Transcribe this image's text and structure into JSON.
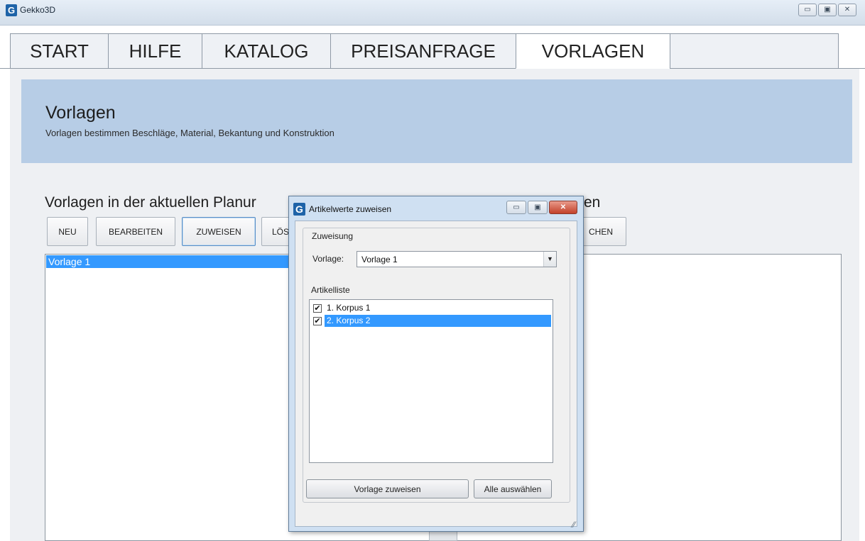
{
  "window": {
    "title": "Gekko3D",
    "app_icon": "G",
    "minimize": "▭",
    "maximize": "▣",
    "close": "✕"
  },
  "tabs": [
    {
      "label": "START"
    },
    {
      "label": "HILFE"
    },
    {
      "label": "KATALOG"
    },
    {
      "label": "PREISANFRAGE"
    },
    {
      "label": "VORLAGEN"
    }
  ],
  "header": {
    "title": "Vorlagen",
    "subtitle": "Vorlagen bestimmen Beschläge, Material, Bekantung und Konstruktion"
  },
  "left_section": {
    "title": "Vorlagen in der aktuellen Planur",
    "buttons": {
      "new": "NEU",
      "edit": "BEARBEITEN",
      "assign": "ZUWEISEN",
      "delete": "LÖS"
    },
    "list": [
      "Vorlage 1"
    ]
  },
  "right_section": {
    "title_fragment": "en",
    "button_fragment": "CHEN"
  },
  "dialog": {
    "title": "Artikelwerte zuweisen",
    "icon": "G",
    "group_label": "Zuweisung",
    "vorlage_label": "Vorlage:",
    "vorlage_value": "Vorlage 1",
    "dropdown_arrow": "▼",
    "list_label": "Artikelliste",
    "items": [
      {
        "label": "1. Korpus 1",
        "checked": "✔"
      },
      {
        "label": "2. Korpus 2",
        "checked": "✔"
      }
    ],
    "assign_button": "Vorlage zuweisen",
    "select_all_button": "Alle auswählen",
    "grip": "⁄⁄"
  }
}
